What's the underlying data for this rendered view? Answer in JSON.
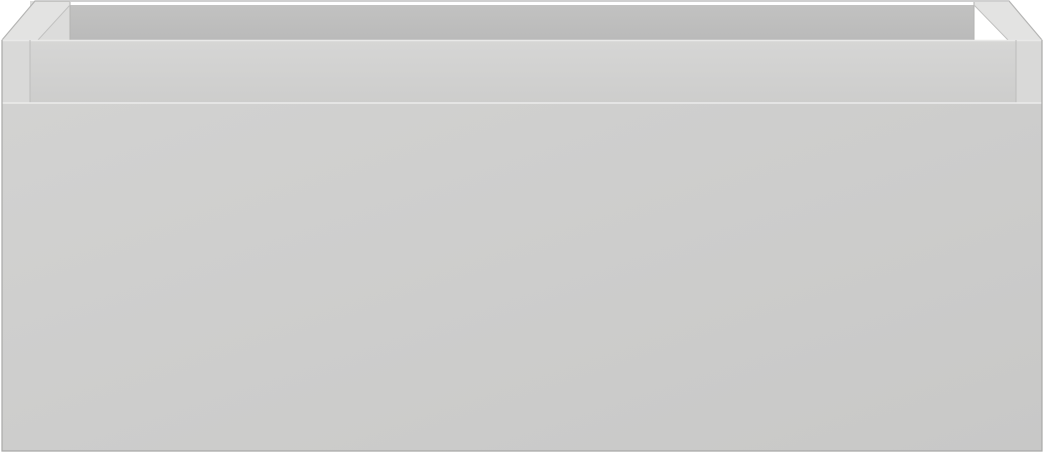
{
  "object": {
    "kind": "drawer",
    "colors": {
      "front_light": "#d2d2d1",
      "front_dark": "#c8c8c7",
      "top_edge": "#e6e6e5",
      "inner_back": "#bdbdbc",
      "inner_side": "#d9d9d8",
      "rim_top": "#e8e8e7",
      "frame_face": "#cfcfce",
      "outline": "#9a9a99"
    }
  }
}
